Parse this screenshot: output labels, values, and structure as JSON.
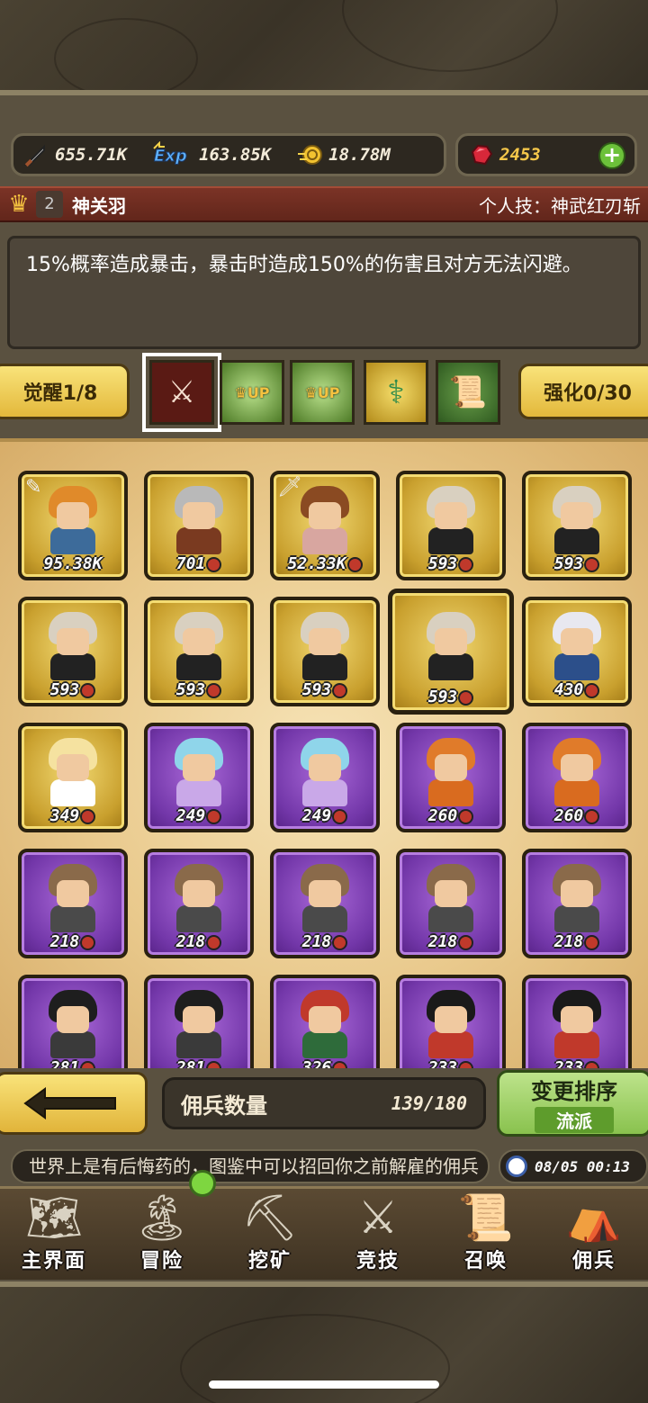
{
  "resources": {
    "attack": {
      "icon": "sword-icon",
      "value": "655.71K"
    },
    "exp": {
      "icon": "exp-icon",
      "value": "163.85K"
    },
    "gold": {
      "icon": "coin-icon",
      "value": "18.78M"
    },
    "gems": {
      "icon": "ruby-icon",
      "value": "2453"
    }
  },
  "hero": {
    "level": "2",
    "name": "神关羽",
    "skill": "个人技：神武红刃斩",
    "description": "15%概率造成暴击，暴击时造成150%的伤害且对方无法闪避。"
  },
  "tabs": {
    "awaken": "觉醒1/8",
    "enhance": "强化0/30",
    "up_label": "UP"
  },
  "mercenaries": [
    {
      "power": "95.38K",
      "rarity": "gold",
      "hair": "#e08a2a",
      "body": "#3d6b9a",
      "tag": "scroll"
    },
    {
      "power": "701",
      "rarity": "gold",
      "hair": "#b9b9b9",
      "body": "#7a3a20"
    },
    {
      "power": "52.33K",
      "rarity": "gold",
      "hair": "#8a4a22",
      "body": "#d8a6a0",
      "tag": "sword"
    },
    {
      "power": "593",
      "rarity": "gold",
      "hair": "#d9d0c0",
      "body": "#222222"
    },
    {
      "power": "593",
      "rarity": "gold",
      "hair": "#d9d0c0",
      "body": "#222222"
    },
    {
      "power": "593",
      "rarity": "gold",
      "hair": "#d9d0c0",
      "body": "#222222"
    },
    {
      "power": "593",
      "rarity": "gold",
      "hair": "#d9d0c0",
      "body": "#222222"
    },
    {
      "power": "593",
      "rarity": "gold",
      "hair": "#d9d0c0",
      "body": "#222222"
    },
    {
      "power": "593",
      "rarity": "gold",
      "hair": "#d9d0c0",
      "body": "#222222",
      "selected": true
    },
    {
      "power": "430",
      "rarity": "gold",
      "hair": "#e8e8f0",
      "body": "#2c4f8a"
    },
    {
      "power": "349",
      "rarity": "gold",
      "hair": "#f5e2a0",
      "body": "#ffffff"
    },
    {
      "power": "249",
      "rarity": "purple",
      "hair": "#8fd5ea",
      "body": "#c9a8e8"
    },
    {
      "power": "249",
      "rarity": "purple",
      "hair": "#8fd5ea",
      "body": "#c9a8e8"
    },
    {
      "power": "260",
      "rarity": "purple",
      "hair": "#e07b2a",
      "body": "#d96b1f"
    },
    {
      "power": "260",
      "rarity": "purple",
      "hair": "#e07b2a",
      "body": "#d96b1f"
    },
    {
      "power": "218",
      "rarity": "purple",
      "hair": "#8a6a4a",
      "body": "#4a4a4a"
    },
    {
      "power": "218",
      "rarity": "purple",
      "hair": "#8a6a4a",
      "body": "#4a4a4a"
    },
    {
      "power": "218",
      "rarity": "purple",
      "hair": "#8a6a4a",
      "body": "#4a4a4a"
    },
    {
      "power": "218",
      "rarity": "purple",
      "hair": "#8a6a4a",
      "body": "#4a4a4a"
    },
    {
      "power": "218",
      "rarity": "purple",
      "hair": "#8a6a4a",
      "body": "#4a4a4a"
    },
    {
      "power": "281",
      "rarity": "purple",
      "hair": "#1e1e1e",
      "body": "#3a3a3a"
    },
    {
      "power": "281",
      "rarity": "purple",
      "hair": "#1e1e1e",
      "body": "#3a3a3a"
    },
    {
      "power": "326",
      "rarity": "purple",
      "hair": "#c0392b",
      "body": "#2e6b3a"
    },
    {
      "power": "233",
      "rarity": "purple",
      "hair": "#1a1a1a",
      "body": "#c0392b"
    },
    {
      "power": "233",
      "rarity": "purple",
      "hair": "#1a1a1a",
      "body": "#c0392b"
    }
  ],
  "footer": {
    "count_label": "佣兵数量",
    "count_value": "139/180",
    "sort_label": "变更排序",
    "sort_mode": "流派"
  },
  "ticker": {
    "message": "世界上是有后悔药的，图鉴中可以招回你之前解雇的佣兵",
    "time": "08/05 00:13"
  },
  "nav": [
    {
      "label": "主界面",
      "icon": "map-scroll-icon"
    },
    {
      "label": "冒险",
      "icon": "island-icon"
    },
    {
      "label": "挖矿",
      "icon": "pickaxe-icon"
    },
    {
      "label": "竞技",
      "icon": "crossed-swords-icon"
    },
    {
      "label": "召唤",
      "icon": "summon-scroll-icon"
    },
    {
      "label": "佣兵",
      "icon": "tent-icon"
    }
  ],
  "colors": {
    "gold_card": "#c9a02e",
    "purple_card": "#7337a9",
    "hero_bar": "#7b3326",
    "accent_green": "#89c24e"
  }
}
